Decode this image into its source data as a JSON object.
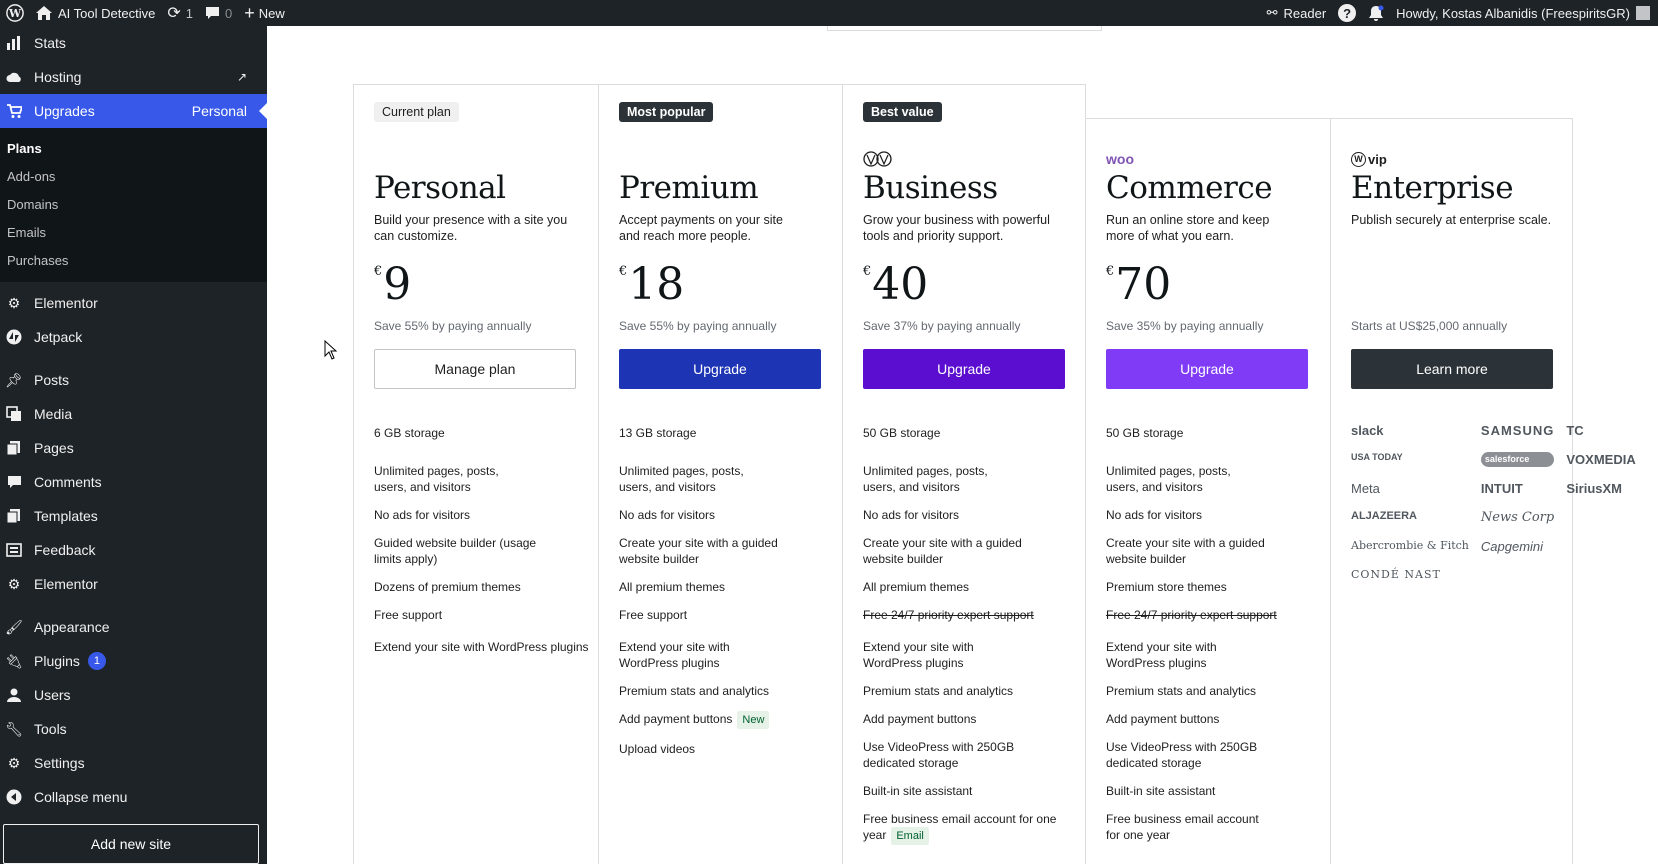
{
  "admin_bar": {
    "site_name": "AI Tool Detective",
    "updates_count": "1",
    "comments_count": "0",
    "new_label": "New",
    "reader_label": "Reader",
    "greeting": "Howdy, Kostas Albanidis (FreespiritsGR)"
  },
  "sidebar": {
    "top_items": [
      {
        "label": "Stats"
      },
      {
        "label": "Hosting"
      }
    ],
    "current": {
      "label": "Upgrades",
      "right": "Personal"
    },
    "submenu": [
      "Plans",
      "Add-ons",
      "Domains",
      "Emails",
      "Purchases"
    ],
    "items": [
      {
        "label": "Elementor"
      },
      {
        "label": "Jetpack"
      },
      {
        "label": "Posts"
      },
      {
        "label": "Media"
      },
      {
        "label": "Pages"
      },
      {
        "label": "Comments"
      },
      {
        "label": "Templates"
      },
      {
        "label": "Feedback"
      },
      {
        "label": "Elementor"
      },
      {
        "label": "Appearance"
      },
      {
        "label": "Plugins",
        "badge": "1"
      },
      {
        "label": "Users"
      },
      {
        "label": "Tools"
      },
      {
        "label": "Settings"
      },
      {
        "label": "Collapse menu"
      }
    ],
    "add_site": "Add new site"
  },
  "plans": [
    {
      "tag": "Current plan",
      "name": "Personal",
      "desc": "Build your presence with a site you can customize.",
      "currency": "€",
      "price": "9",
      "save": "Save 55% by paying annually",
      "button": "Manage plan",
      "features": [
        "6 GB storage",
        "Unlimited pages, posts, users, and visitors",
        "No ads for visitors",
        "Guided website builder (usage limits apply)",
        "Dozens of premium themes",
        "Free support",
        "Extend your site with WordPress plugins"
      ]
    },
    {
      "tag": "Most popular",
      "name": "Premium",
      "desc": "Accept payments on your site and reach more people.",
      "currency": "€",
      "price": "18",
      "save": "Save 55% by paying annually",
      "button": "Upgrade",
      "features": [
        "13 GB storage",
        "Unlimited pages, posts, users, and visitors",
        "No ads for visitors",
        "Create your site with a guided website builder",
        "All premium themes",
        "Free support",
        "Extend your site with WordPress plugins",
        "Premium stats and analytics",
        "Add payment buttons",
        "Upload videos"
      ],
      "new_badge": "New"
    },
    {
      "tag": "Best value",
      "name": "Business",
      "desc": "Grow your business with powerful tools and priority support.",
      "currency": "€",
      "price": "40",
      "save": "Save 37% by paying annually",
      "button": "Upgrade",
      "features": [
        "50 GB storage",
        "Unlimited pages, posts, users, and visitors",
        "No ads for visitors",
        "Create your site with a guided website builder",
        "All premium themes",
        "Free 24/7 priority expert support",
        "Extend your site with WordPress plugins",
        "Premium stats and analytics",
        "Add payment buttons",
        "Use VideoPress with 250GB dedicated storage",
        "Built-in site assistant",
        "Free business email account for one year"
      ],
      "email_badge": "Email"
    },
    {
      "logo": "woo",
      "name": "Commerce",
      "desc": "Run an online store and keep more of what you earn.",
      "currency": "€",
      "price": "70",
      "save": "Save 35% by paying annually",
      "button": "Upgrade",
      "features": [
        "50 GB storage",
        "Unlimited pages, posts, users, and visitors",
        "No ads for visitors",
        "Create your site with a guided website builder",
        "Premium store themes",
        "Free 24/7 priority expert support",
        "Extend your site with WordPress plugins",
        "Premium stats and analytics",
        "Add payment buttons",
        "Use VideoPress with 250GB dedicated storage",
        "Built-in site assistant",
        "Free business email account for one year"
      ]
    },
    {
      "logo": "vip",
      "name": "Enterprise",
      "desc": "Publish securely at enterprise scale.",
      "save": "Starts at US$25,000 annually",
      "button": "Learn more",
      "clients": [
        "slack",
        "SAMSUNG",
        "TC",
        "USA TODAY",
        "salesforce",
        "VOXMEDIA",
        "Meta",
        "INTUIT",
        "SiriusXM",
        "ALJAZEERA",
        "News Corp",
        "",
        "Abercrombie & Fitch",
        "Capgemini",
        "",
        "CONDÉ NAST"
      ]
    }
  ],
  "colors": {
    "admin_bg": "#1d2327",
    "accent": "#3858e9",
    "premium_btn": "#1d35b4",
    "business_btn": "#5b0ecf",
    "commerce_btn": "#7f3bf5",
    "enterprise_btn": "#2c3338"
  }
}
